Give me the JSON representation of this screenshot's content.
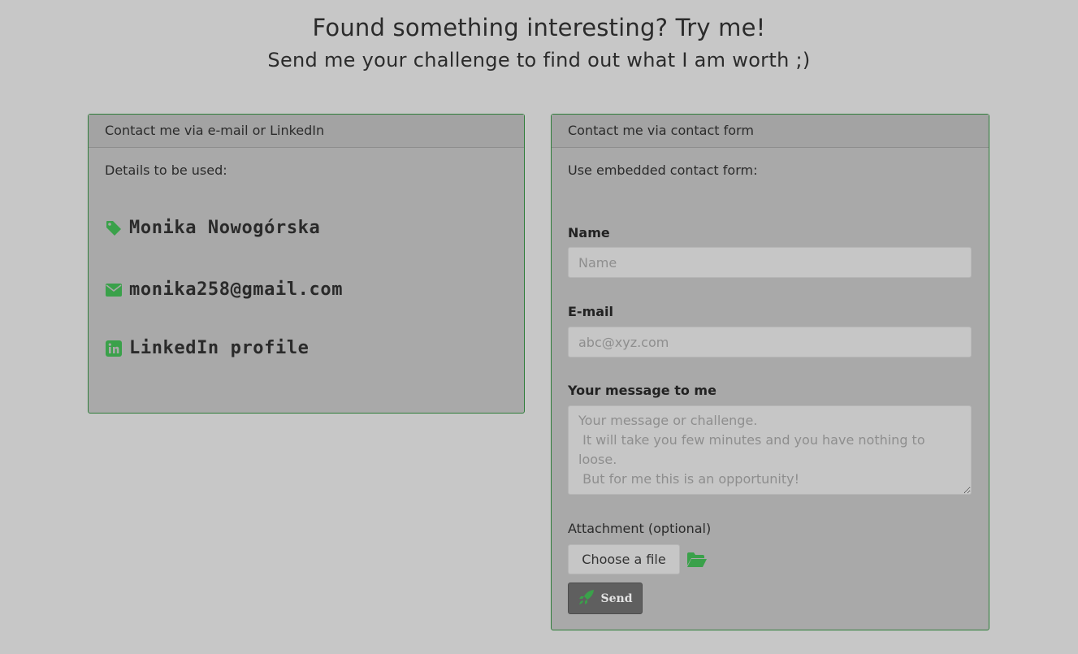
{
  "header": {
    "title": "Found something interesting? Try me!",
    "subtitle": "Send me your challenge to find out what I am worth ;)"
  },
  "left_card": {
    "header": "Contact me via e-mail or LinkedIn",
    "intro": "Details to be used:",
    "name": "Monika Nowogórska",
    "email": "monika258@gmail.com",
    "linkedin": "LinkedIn profile"
  },
  "right_card": {
    "header": "Contact me via contact form",
    "intro": "Use embedded contact form:",
    "name_label": "Name",
    "name_placeholder": "Name",
    "email_label": "E-mail",
    "email_placeholder": "abc@xyz.com",
    "message_label": "Your message to me",
    "message_placeholder": "Your message or challenge.\n It will take you few minutes and you have nothing to loose.\n But for me this is an opportunity!",
    "attachment_label": "Attachment (optional)",
    "file_button": "Choose a file",
    "send_button": "Send"
  },
  "colors": {
    "accent_green": "#3aa14a",
    "background": "#c7c7c7",
    "card_background": "#a9a9a9",
    "card_border": "#2f7d3a"
  },
  "icons": {
    "name": "tag-icon",
    "email": "envelope-icon",
    "linkedin": "linkedin-icon",
    "folder": "folder-open-icon",
    "send": "rocket-icon"
  }
}
